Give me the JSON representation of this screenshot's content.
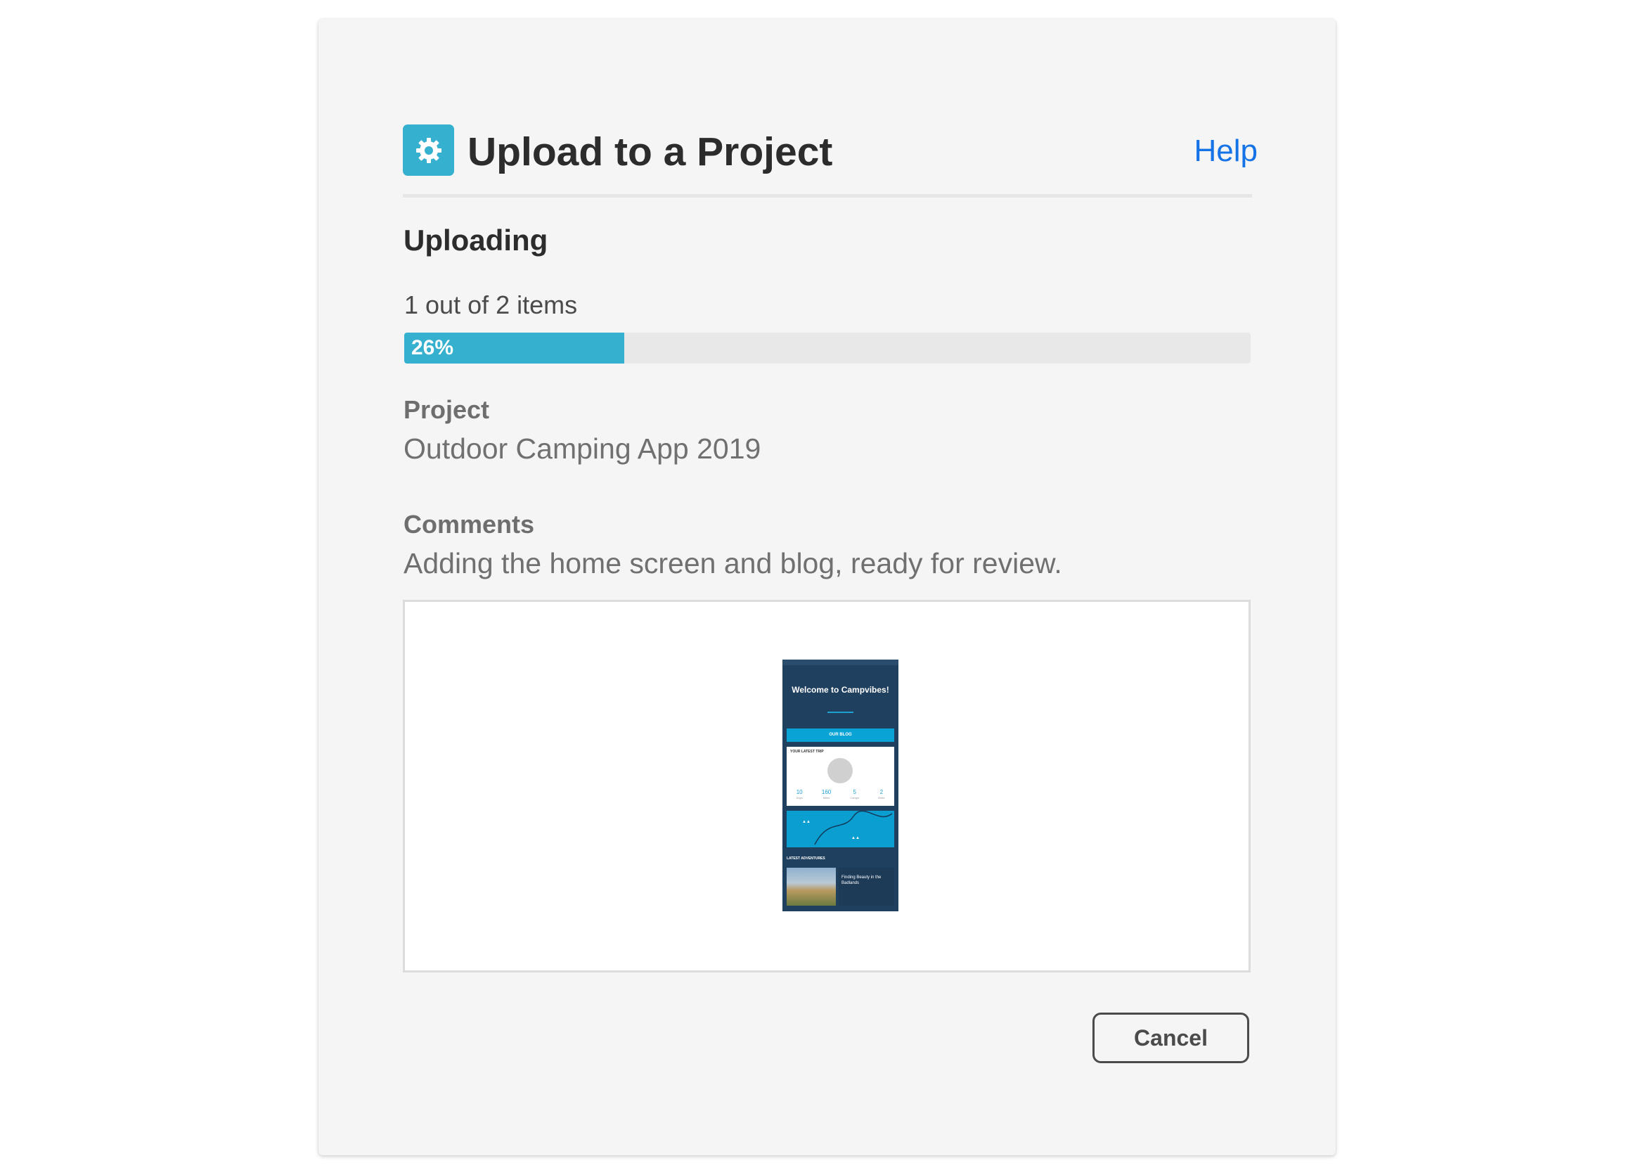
{
  "dialog": {
    "title": "Upload to a Project",
    "help_label": "Help",
    "icon": "gear-icon",
    "accent_color": "#35b0cf",
    "link_color": "#1473e6"
  },
  "status": {
    "heading": "Uploading",
    "items_text": "1 out of 2 items",
    "progress_percent": 26,
    "progress_label": "26%"
  },
  "project": {
    "label": "Project",
    "value": "Outdoor Camping App 2019"
  },
  "comments": {
    "label": "Comments",
    "value": "Adding the home screen and blog, ready for review."
  },
  "preview": {
    "welcome": "Welcome to Campvibes!",
    "blog_button": "OUR BLOG",
    "trip_title": "YOUR LATEST TRIP",
    "stats": [
      {
        "value": "10",
        "label": "Days"
      },
      {
        "value": "160",
        "label": "Miles"
      },
      {
        "value": "5",
        "label": "Camps"
      },
      {
        "value": "2",
        "label": "Birds"
      }
    ],
    "adventures_title": "LATEST ADVENTURES",
    "adventure_title": "Finding Beauty in the Badlands"
  },
  "actions": {
    "cancel_label": "Cancel"
  }
}
